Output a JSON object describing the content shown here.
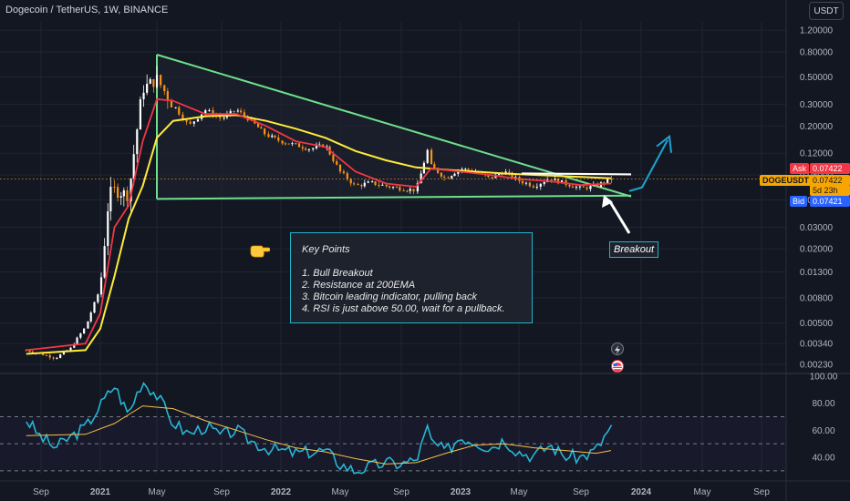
{
  "header": {
    "title": "Dogecoin / TetherUS, 1W, BINANCE"
  },
  "toolbar": {
    "currency_button": "USDT"
  },
  "price_labels": {
    "ask_label": "Ask",
    "ask_value": "0.07422",
    "symbol_label": "DOGEUSDT",
    "symbol_value": "0.07422",
    "countdown": "5d 23h",
    "bid_label": "Bid",
    "bid_value": "0.07421"
  },
  "annotations": {
    "key_points_title": "Key Points",
    "key_points": [
      "1. Bull Breakout",
      "2. Resistance at 200EMA",
      "3. Bitcoin leading indicator, pulling back",
      "4. RSI is just above 50.00, wait for a pullback."
    ],
    "breakout_label": "Breakout"
  },
  "colors": {
    "background": "#131722",
    "grid": "#1f2433",
    "candle_up": "#ffffff",
    "candle_down": "#f7931a",
    "ema_fast": "#f23645",
    "ema_slow": "#ffeb3b",
    "triangle": "#6ee08c",
    "arrow": "#1fa3d1",
    "rsi": "#26b6d4",
    "rsi_ma": "#f7c14a",
    "current_price_line": "#f7931a"
  },
  "chart_data": [
    {
      "type": "candlestick",
      "scale": "log",
      "x_tick_labels": [
        "Sep",
        "2021",
        "May",
        "Sep",
        "2022",
        "May",
        "Sep",
        "2023",
        "May",
        "Sep",
        "2024",
        "May",
        "Sep"
      ],
      "y_tick_labels": [
        "1.20000",
        "0.80000",
        "0.50000",
        "0.30000",
        "0.20000",
        "0.12000",
        "0.08000",
        "0.05000",
        "0.03000",
        "0.02000",
        "0.01300",
        "0.00800",
        "0.00500",
        "0.00340",
        "0.00230"
      ],
      "ylim": [
        0.0022,
        1.5
      ],
      "series": [
        {
          "name": "price",
          "points": [
            [
              "2020-08",
              0.003
            ],
            [
              "2020-09",
              0.0028
            ],
            [
              "2020-10",
              0.0026
            ],
            [
              "2020-11",
              0.0031
            ],
            [
              "2020-12",
              0.0046
            ],
            [
              "2021-01",
              0.0095
            ],
            [
              "2021-01-20",
              0.055
            ],
            [
              "2021-02",
              0.06
            ],
            [
              "2021-03",
              0.055
            ],
            [
              "2021-04",
              0.4
            ],
            [
              "2021-05",
              0.48
            ],
            [
              "2021-06",
              0.3
            ],
            [
              "2021-07",
              0.2
            ],
            [
              "2021-08",
              0.27
            ],
            [
              "2021-09",
              0.23
            ],
            [
              "2021-10",
              0.27
            ],
            [
              "2021-11",
              0.22
            ],
            [
              "2021-12",
              0.17
            ],
            [
              "2022-01",
              0.15
            ],
            [
              "2022-02",
              0.14
            ],
            [
              "2022-03",
              0.13
            ],
            [
              "2022-04",
              0.14
            ],
            [
              "2022-05",
              0.085
            ],
            [
              "2022-06",
              0.065
            ],
            [
              "2022-07",
              0.069
            ],
            [
              "2022-08",
              0.065
            ],
            [
              "2022-09",
              0.062
            ],
            [
              "2022-10",
              0.06
            ],
            [
              "2022-10-28",
              0.14
            ],
            [
              "2022-11",
              0.095
            ],
            [
              "2022-12",
              0.075
            ],
            [
              "2023-01",
              0.09
            ],
            [
              "2023-02",
              0.085
            ],
            [
              "2023-03",
              0.075
            ],
            [
              "2023-04",
              0.085
            ],
            [
              "2023-05",
              0.072
            ],
            [
              "2023-06",
              0.065
            ],
            [
              "2023-07",
              0.075
            ],
            [
              "2023-08",
              0.068
            ],
            [
              "2023-09",
              0.062
            ],
            [
              "2023-10",
              0.065
            ],
            [
              "2023-11",
              0.074
            ]
          ]
        },
        {
          "name": "ema_fast",
          "points": [
            [
              "2020-08",
              0.003
            ],
            [
              "2020-12",
              0.0034
            ],
            [
              "2021-01",
              0.006
            ],
            [
              "2021-02",
              0.03
            ],
            [
              "2021-03",
              0.045
            ],
            [
              "2021-04",
              0.15
            ],
            [
              "2021-05",
              0.33
            ],
            [
              "2021-06",
              0.32
            ],
            [
              "2021-08",
              0.25
            ],
            [
              "2021-10",
              0.25
            ],
            [
              "2021-12",
              0.2
            ],
            [
              "2022-02",
              0.15
            ],
            [
              "2022-04",
              0.135
            ],
            [
              "2022-06",
              0.085
            ],
            [
              "2022-08",
              0.068
            ],
            [
              "2022-10",
              0.064
            ],
            [
              "2022-11",
              0.09
            ],
            [
              "2023-01",
              0.085
            ],
            [
              "2023-03",
              0.08
            ],
            [
              "2023-05",
              0.074
            ],
            [
              "2023-07",
              0.071
            ],
            [
              "2023-09",
              0.066
            ],
            [
              "2023-11",
              0.068
            ]
          ]
        },
        {
          "name": "ema_slow",
          "points": [
            [
              "2020-08",
              0.0028
            ],
            [
              "2020-12",
              0.003
            ],
            [
              "2021-01",
              0.0045
            ],
            [
              "2021-02",
              0.012
            ],
            [
              "2021-03",
              0.035
            ],
            [
              "2021-04",
              0.065
            ],
            [
              "2021-05",
              0.16
            ],
            [
              "2021-06",
              0.22
            ],
            [
              "2021-08",
              0.24
            ],
            [
              "2021-10",
              0.245
            ],
            [
              "2021-12",
              0.22
            ],
            [
              "2022-02",
              0.19
            ],
            [
              "2022-04",
              0.16
            ],
            [
              "2022-06",
              0.125
            ],
            [
              "2022-08",
              0.105
            ],
            [
              "2022-10",
              0.092
            ],
            [
              "2022-12",
              0.088
            ],
            [
              "2023-02",
              0.085
            ],
            [
              "2023-04",
              0.082
            ],
            [
              "2023-06",
              0.08
            ],
            [
              "2023-08",
              0.078
            ],
            [
              "2023-11",
              0.075
            ]
          ]
        }
      ],
      "triangle": {
        "apex_top": [
          "2021-05",
          0.76
        ],
        "end_top": [
          "2023-11",
          0.075
        ],
        "baseline": 0.051
      },
      "resistance_line": {
        "start": [
          "2023-03",
          0.085
        ],
        "end": [
          "2023-11",
          0.085
        ]
      }
    },
    {
      "type": "line",
      "name": "RSI",
      "y_tick_labels": [
        "100.00",
        "80.00",
        "60.00",
        "40.00"
      ],
      "ylim": [
        25,
        102
      ],
      "bands": [
        70,
        50,
        30
      ],
      "series": [
        {
          "name": "rsi",
          "points": [
            [
              "2020-08",
              68
            ],
            [
              "2020-09",
              55
            ],
            [
              "2020-10",
              47
            ],
            [
              "2020-11",
              55
            ],
            [
              "2020-12",
              62
            ],
            [
              "2021-01",
              78
            ],
            [
              "2021-02",
              93
            ],
            [
              "2021-03",
              72
            ],
            [
              "2021-04",
              97
            ],
            [
              "2021-05",
              86
            ],
            [
              "2021-06",
              66
            ],
            [
              "2021-07",
              57
            ],
            [
              "2021-08",
              63
            ],
            [
              "2021-09",
              56
            ],
            [
              "2021-10",
              60
            ],
            [
              "2021-11",
              52
            ],
            [
              "2021-12",
              47
            ],
            [
              "2022-01",
              45
            ],
            [
              "2022-02",
              43
            ],
            [
              "2022-03",
              44
            ],
            [
              "2022-04",
              45
            ],
            [
              "2022-05",
              35
            ],
            [
              "2022-06",
              30
            ],
            [
              "2022-07",
              33
            ],
            [
              "2022-08",
              36
            ],
            [
              "2022-09",
              35
            ],
            [
              "2022-10",
              38
            ],
            [
              "2022-10-28",
              64
            ],
            [
              "2022-11",
              52
            ],
            [
              "2022-12",
              44
            ],
            [
              "2023-01",
              55
            ],
            [
              "2023-02",
              52
            ],
            [
              "2023-03",
              47
            ],
            [
              "2023-04",
              53
            ],
            [
              "2023-05",
              44
            ],
            [
              "2023-06",
              41
            ],
            [
              "2023-07",
              49
            ],
            [
              "2023-08",
              41
            ],
            [
              "2023-09",
              40
            ],
            [
              "2023-10",
              45
            ],
            [
              "2023-11",
              62
            ]
          ]
        },
        {
          "name": "rsi_ma",
          "points": [
            [
              "2020-08",
              56
            ],
            [
              "2020-12",
              57
            ],
            [
              "2021-02",
              65
            ],
            [
              "2021-04",
              78
            ],
            [
              "2021-06",
              76
            ],
            [
              "2021-08",
              67
            ],
            [
              "2021-10",
              60
            ],
            [
              "2021-12",
              53
            ],
            [
              "2022-02",
              47
            ],
            [
              "2022-04",
              44
            ],
            [
              "2022-06",
              39
            ],
            [
              "2022-08",
              35
            ],
            [
              "2022-10",
              36
            ],
            [
              "2022-12",
              43
            ],
            [
              "2023-02",
              49
            ],
            [
              "2023-04",
              50
            ],
            [
              "2023-06",
              47
            ],
            [
              "2023-08",
              45
            ],
            [
              "2023-10",
              43
            ],
            [
              "2023-11",
              45
            ]
          ]
        }
      ]
    }
  ]
}
